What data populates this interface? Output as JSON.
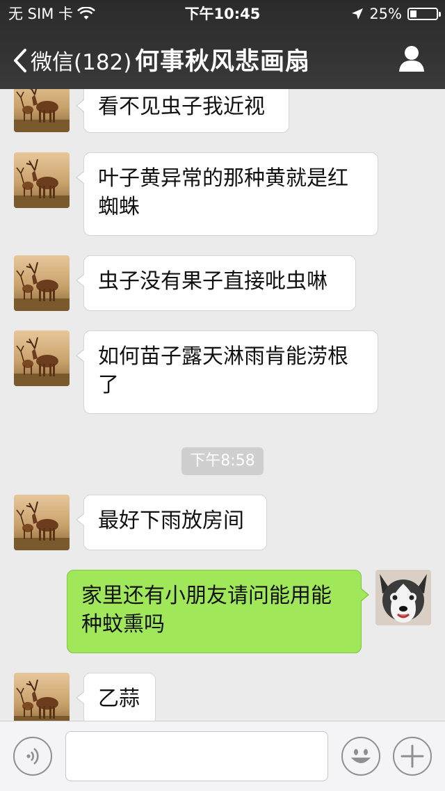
{
  "status": {
    "carrier": "无 SIM 卡",
    "time": "下午10:45",
    "battery": "25%"
  },
  "nav": {
    "back_label": "微信(182)",
    "title": "何事秋风悲画扇"
  },
  "messages": [
    {
      "side": "left",
      "text": "看不见虫子我近视"
    },
    {
      "side": "left",
      "text": "叶子黄异常的那种黄就是红\n蜘蛛"
    },
    {
      "side": "left",
      "text": "虫子没有果子直接吡虫啉"
    },
    {
      "side": "left",
      "text": "如何苗子露天淋雨肯能涝根\n了"
    },
    {
      "side": "left",
      "text": "最好下雨放房间"
    },
    {
      "side": "right",
      "text": "家里还有小朋友请问能用能\n种蚊熏吗"
    },
    {
      "side": "left",
      "text": "乙蒜"
    }
  ],
  "timestamp": "下午8:58",
  "colors": {
    "header_bg": "#333333",
    "chat_bg": "#ebebeb",
    "bubble_received": "#ffffff",
    "bubble_sent": "#a0e75a"
  },
  "icons": {
    "back": "chevron-left-icon",
    "profile": "person-icon",
    "voice": "voice-icon",
    "emoji": "emoji-icon",
    "plus": "plus-icon"
  }
}
